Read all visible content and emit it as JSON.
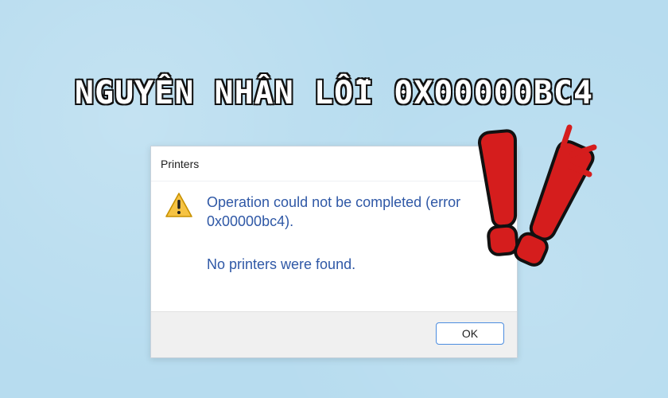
{
  "headline": "NGUYÊN NHÂN LỖI 0X00000BC4",
  "dialog": {
    "title": "Printers",
    "message_line_1": "Operation could not be completed (error",
    "message_line_2": "0x00000bc4).",
    "message_line_3": "No printers were found.",
    "ok_label": "OK"
  },
  "icons": {
    "warning": "warning-icon",
    "alert_decoration": "exclamation-icon"
  },
  "colors": {
    "background": "#b7dcef",
    "message_text": "#2f58a6",
    "exclamation_red": "#d51d1d",
    "outline": "#111111"
  }
}
